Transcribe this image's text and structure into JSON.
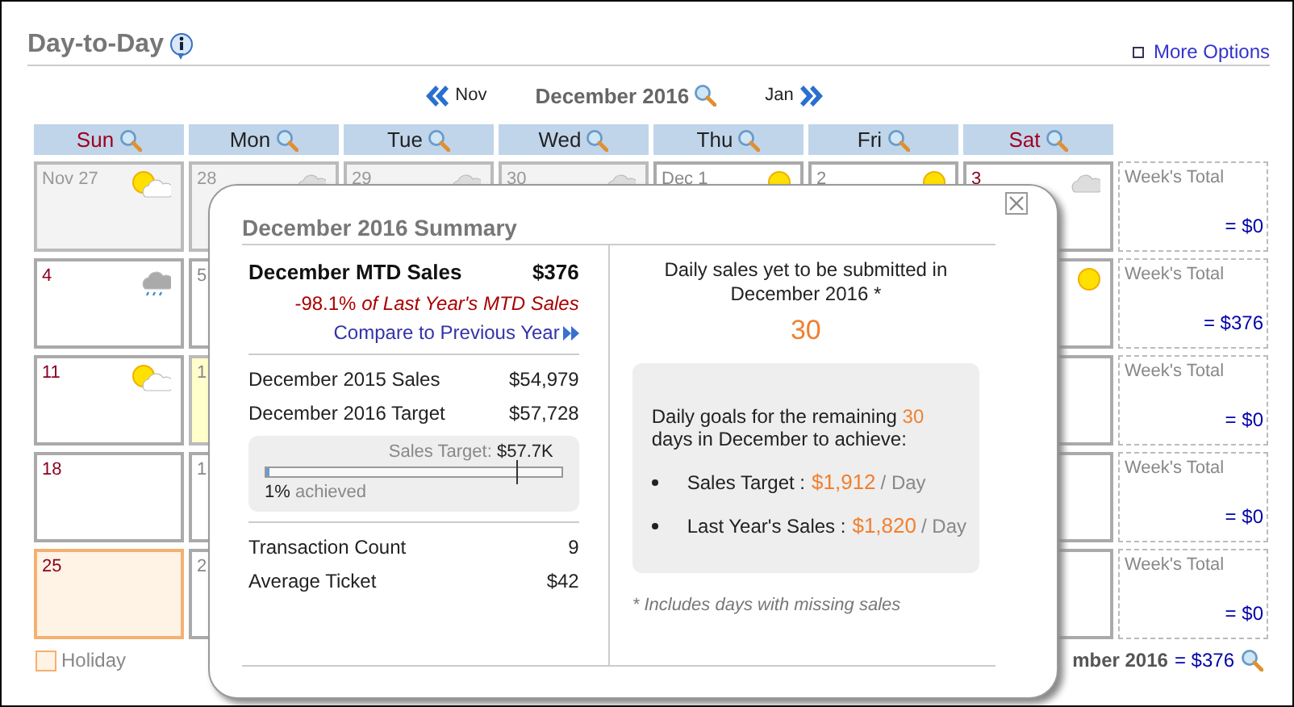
{
  "header": {
    "title": "Day-to-Day",
    "more_options": "More Options"
  },
  "nav": {
    "prev": "Nov",
    "month": "December 2016",
    "next": "Jan"
  },
  "weekdays": [
    {
      "label": "Sun",
      "weekend": true
    },
    {
      "label": "Mon",
      "weekend": false
    },
    {
      "label": "Tue",
      "weekend": false
    },
    {
      "label": "Wed",
      "weekend": false
    },
    {
      "label": "Thu",
      "weekend": false
    },
    {
      "label": "Fri",
      "weekend": false
    },
    {
      "label": "Sat",
      "weekend": true
    }
  ],
  "weeks": [
    {
      "days": [
        {
          "date": "Nov 27",
          "kind": "other_month",
          "weather": {
            "kind": "partly_cloudy"
          }
        },
        {
          "date": "28",
          "kind": "other_month",
          "weather": {
            "kind": "cloudy"
          }
        },
        {
          "date": "29",
          "kind": "other_month",
          "weather": {
            "kind": "cloudy"
          }
        },
        {
          "date": "30",
          "kind": "other_month",
          "weather": {
            "kind": "cloudy"
          }
        },
        {
          "date": "Dec 1",
          "kind": "plain",
          "weather": {
            "kind": "sunny"
          }
        },
        {
          "date": "2",
          "kind": "plain",
          "weather": {
            "kind": "sunny"
          }
        },
        {
          "date": "3",
          "kind": "plain",
          "weather": {
            "kind": "cloudy"
          }
        }
      ],
      "total_label": "Week's Total",
      "total": "= $0"
    },
    {
      "days": [
        {
          "date": "4",
          "kind": "plain",
          "weather": {
            "kind": "rain"
          }
        },
        {
          "date": "5",
          "kind": "plain"
        },
        {
          "kind": "plain",
          "weather": {
            "kind": "sunny"
          }
        }
      ],
      "total_label": "Week's Total",
      "total": "= $376"
    },
    {
      "days": [
        {
          "date": "11",
          "kind": "plain",
          "weather": {
            "kind": "partly_cloudy"
          }
        },
        {
          "date": "1",
          "kind": "today"
        },
        {
          "kind": "plain"
        }
      ],
      "total_label": "Week's Total",
      "total": "= $0"
    },
    {
      "days": [
        {
          "date": "18",
          "kind": "plain"
        },
        {
          "date": "1",
          "kind": "plain"
        },
        {
          "kind": "plain"
        }
      ],
      "total_label": "Week's Total",
      "total": "= $0"
    },
    {
      "days": [
        {
          "date": "25",
          "kind": "holiday"
        },
        {
          "date": "2",
          "kind": "plain"
        },
        {
          "kind": "plain"
        }
      ],
      "total_label": "Week's Total",
      "total": "= $0"
    }
  ],
  "legend": {
    "label": "Holiday"
  },
  "month_total": {
    "label": "mber 2016",
    "value": "= $376"
  },
  "summary": {
    "title": "December 2016 Summary",
    "mtd": {
      "label": "December MTD Sales",
      "value": "$376",
      "comparison": "-98.1% *of Last Year's MTD Sales*",
      "link": "Compare to Previous Year"
    },
    "rows": [
      {
        "label": "December 2015 Sales",
        "value": "$54,979"
      },
      {
        "label": "December 2016 Target",
        "value": "$57,728"
      }
    ],
    "target": {
      "label": "Sales Target:",
      "value": "$57.7K",
      "level": 0.01,
      "percent": "1%",
      "achieved": "achieved"
    },
    "stats": [
      {
        "label": "Transaction Count",
        "value": "9"
      },
      {
        "label": "Average Ticket",
        "value": "$42"
      }
    ],
    "pending": {
      "text": "Daily sales yet to be submitted in December 2016 *",
      "count": "30"
    },
    "goals": {
      "intro_before": "Daily goals for the remaining",
      "intro_count": "30",
      "intro_after": "days in December to achieve:",
      "items": [
        {
          "label": "Sales Target :",
          "value": "$1,912",
          "unit": "/ Day"
        },
        {
          "label": "Last Year's Sales :",
          "value": "$1,820",
          "unit": "/ Day"
        }
      ]
    },
    "footnote": "* Includes days with missing sales"
  }
}
